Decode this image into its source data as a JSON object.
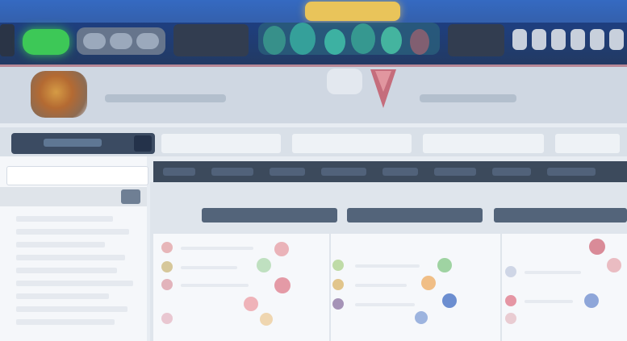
{
  "colors": {
    "topbar": "#1e3f82",
    "accent_green": "#3dc857",
    "accent_gold": "#e9c45a",
    "banner": "#cfd7e2",
    "sidebar": "#f5f7fa",
    "menu_dark": "#3c4a5c"
  },
  "header": {
    "logo_icon": "sportsbook-logo-icon",
    "promo_icon": "promo-banner-icon",
    "account_icons": [
      "bell-icon",
      "user-icon",
      "wallet-icon",
      "settings-icon",
      "menu-icon"
    ]
  },
  "banner": {
    "emblem_icon": "team-crest-icon",
    "flag_icon": "pennant-icon"
  },
  "filters": {
    "tabs": [
      "",
      "",
      "",
      ""
    ]
  },
  "sidebar": {
    "search_placeholder": "",
    "go_icon": "search-icon"
  },
  "main": {
    "menu_items": [
      "",
      "",
      "",
      "",
      "",
      "",
      "",
      ""
    ],
    "columns": [
      "",
      "",
      ""
    ]
  }
}
